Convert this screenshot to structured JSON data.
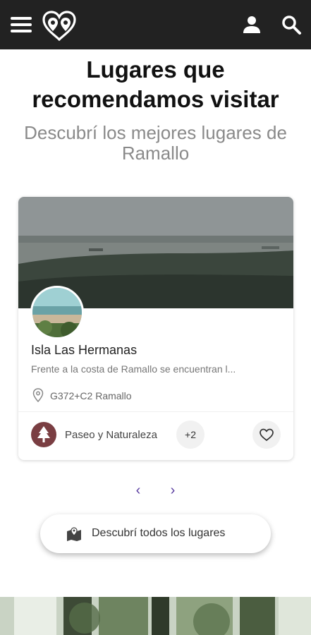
{
  "header": {
    "menu_icon": "hamburger-menu-icon",
    "logo_icon": "heart-pins-logo",
    "user_icon": "user-icon",
    "search_icon": "search-icon",
    "background": "#222222"
  },
  "section": {
    "title": "Lugares que recomendamos visitar",
    "subtitle": "Descubrí los mejores lugares de Ramallo"
  },
  "card": {
    "name": "Isla Las Hermanas",
    "description": "Frente a la costa de Ramallo se encuentran l...",
    "location_icon": "map-pin-icon",
    "location": "G372+C2 Ramallo",
    "category_icon": "tree-icon",
    "category": "Paseo y Naturaleza",
    "category_color": "#7a3e42",
    "more_count": "+2",
    "favorite_icon": "heart-outline-icon"
  },
  "carousel": {
    "prev_icon": "chevron-left-icon",
    "next_icon": "chevron-right-icon",
    "prev_glyph": "‹",
    "next_glyph": "›",
    "accent": "#5a3ea0"
  },
  "discover_button": {
    "icon": "map-marker-icon",
    "label": "Descubrí todos los lugares"
  }
}
